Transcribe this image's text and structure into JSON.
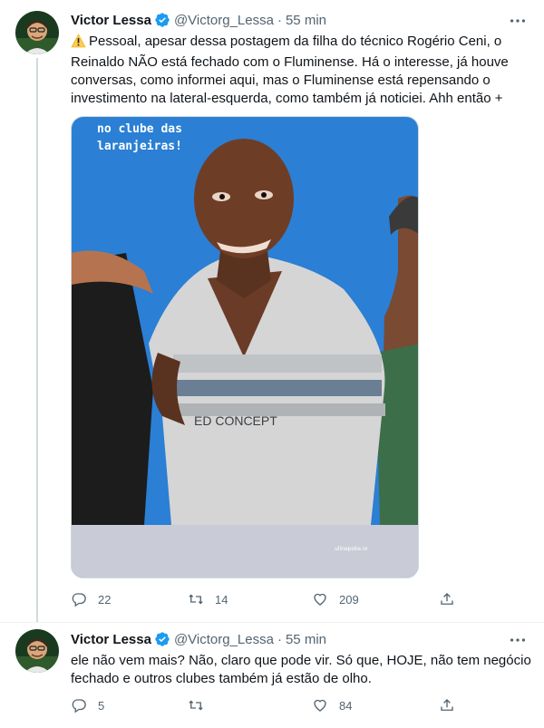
{
  "tweets": [
    {
      "author": {
        "name": "Victor Lessa",
        "handle": "@Victorg_Lessa",
        "time": "55 min"
      },
      "text_parts": {
        "text": "Pessoal, apesar dessa postagem da filha do técnico Rogério Ceni, o Reinaldo NÃO está fechado com o Fluminense. Há o interesse, já houve conversas, como informei aqui, mas o Fluminense está repensando o investimento na lateral-esquerda, como também já noticiei. Ahh então +"
      },
      "media": {
        "caption": "no clube das\nlaranjeiras!",
        "watermark": "ulinepoke.io"
      },
      "actions": {
        "replies": "22",
        "retweets": "14",
        "likes": "209"
      }
    },
    {
      "author": {
        "name": "Victor Lessa",
        "handle": "@Victorg_Lessa",
        "time": "55 min"
      },
      "text_parts": {
        "text": "ele não vem mais? Não, claro que pode vir. Só que, HOJE, não tem negócio fechado e outros clubes também já estão de olho."
      },
      "actions": {
        "replies": "5",
        "retweets": "",
        "likes": "84"
      }
    }
  ],
  "colors": {
    "verified": "#1d9bf0",
    "secondary_text": "#536471",
    "thread_line": "#cfd9de",
    "photo_bg": "#2b7fd4"
  },
  "icons": [
    "verified-badge-icon",
    "more-icon",
    "warning-icon",
    "reply-icon",
    "retweet-icon",
    "like-icon",
    "share-icon"
  ]
}
